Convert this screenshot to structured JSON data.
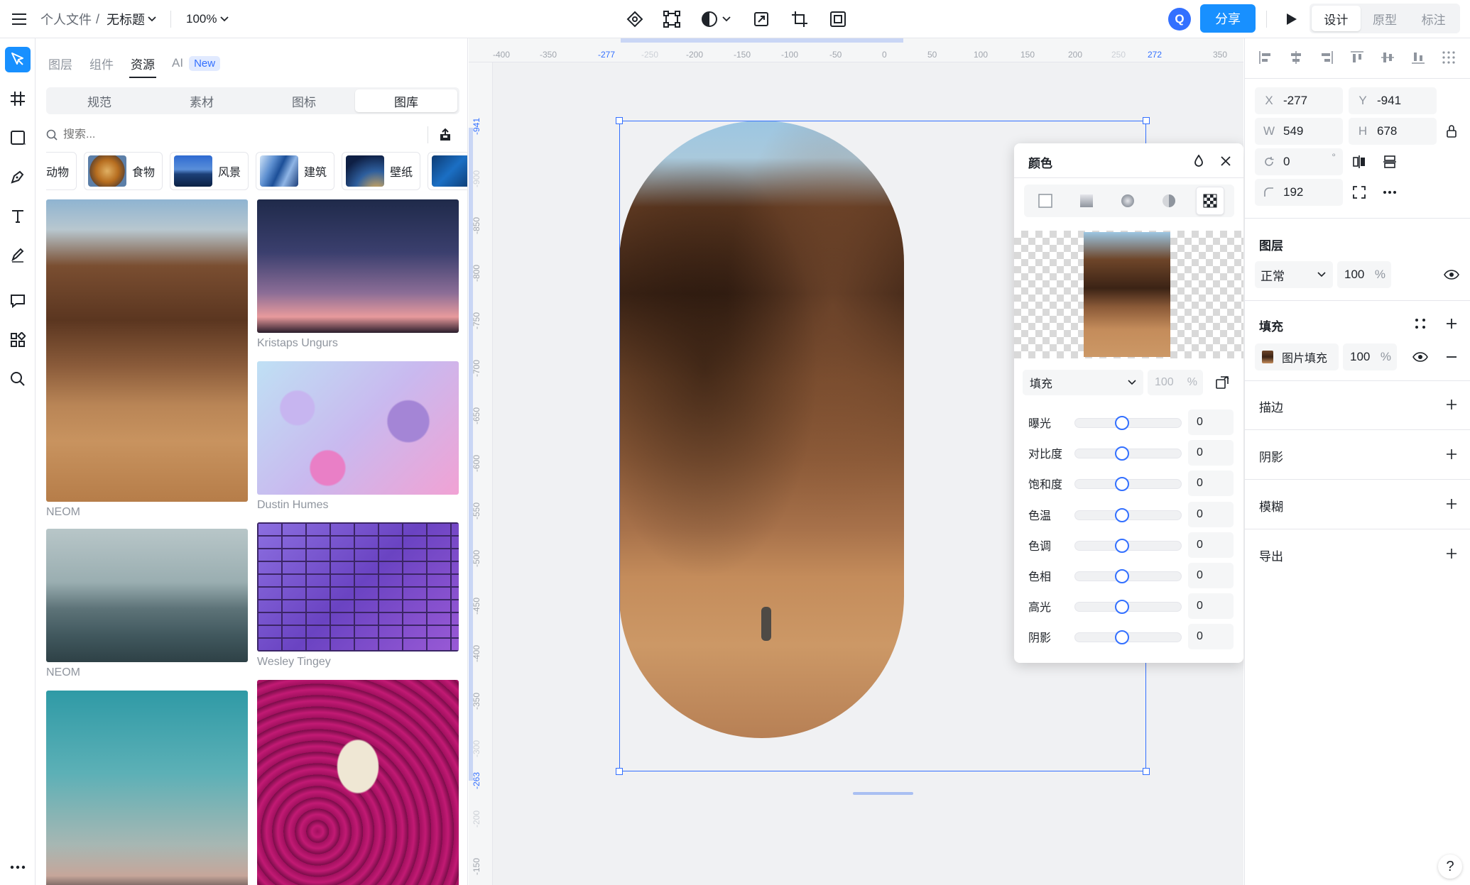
{
  "topbar": {
    "breadcrumb_root": "个人文件",
    "breadcrumb_sep": "/",
    "breadcrumb_current": "无标题",
    "zoom": "100%",
    "avatar_initial": "Q",
    "share_label": "分享",
    "modes": [
      "设计",
      "原型",
      "标注"
    ]
  },
  "left_panel": {
    "tabs": [
      "图层",
      "组件",
      "资源",
      "AI"
    ],
    "ai_badge": "New",
    "segments": [
      "规范",
      "素材",
      "图标",
      "图库"
    ],
    "search_placeholder": "搜索...",
    "categories": [
      "动物",
      "食物",
      "风景",
      "建筑",
      "壁纸"
    ],
    "captions": [
      "NEOM",
      "Kristaps Ungurs",
      "Dustin Humes",
      "NEOM",
      "Wesley Tingey"
    ]
  },
  "canvas": {
    "h_ticks": [
      "-400",
      "-350",
      "-277",
      "-250",
      "-200",
      "-150",
      "-100",
      "-50",
      "0",
      "50",
      "100",
      "150",
      "200",
      "250",
      "272",
      "350"
    ],
    "v_ticks": [
      "-941",
      "-900",
      "-850",
      "-800",
      "-750",
      "-700",
      "-650",
      "-600",
      "-550",
      "-500",
      "-450",
      "-400",
      "-350",
      "-300",
      "-263",
      "-200",
      "-150"
    ]
  },
  "color_popup": {
    "title": "颜色",
    "fill_mode": "填充",
    "opacity": "100",
    "percent": "%",
    "adjustments": [
      {
        "label": "曝光",
        "value": "0"
      },
      {
        "label": "对比度",
        "value": "0"
      },
      {
        "label": "饱和度",
        "value": "0"
      },
      {
        "label": "色温",
        "value": "0"
      },
      {
        "label": "色调",
        "value": "0"
      },
      {
        "label": "色相",
        "value": "0"
      },
      {
        "label": "高光",
        "value": "0"
      },
      {
        "label": "阴影",
        "value": "0"
      }
    ]
  },
  "right_panel": {
    "x_label": "X",
    "x": "-277",
    "y_label": "Y",
    "y": "-941",
    "w_label": "W",
    "w": "549",
    "h_label": "H",
    "h": "678",
    "rotation": "0",
    "degree": "°",
    "radius": "192",
    "layer_title": "图层",
    "blend_mode": "正常",
    "layer_opacity": "100",
    "percent": "%",
    "fill_title": "填充",
    "fill_type": "图片填充",
    "fill_opacity": "100",
    "stroke_title": "描边",
    "shadow_title": "阴影",
    "blur_title": "模糊",
    "export_title": "导出"
  },
  "help_label": "?"
}
